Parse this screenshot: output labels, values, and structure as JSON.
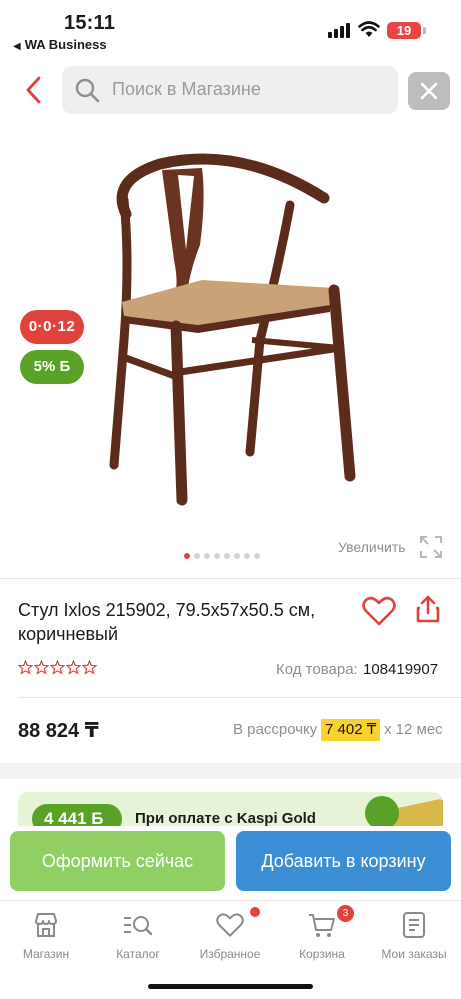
{
  "status_bar": {
    "time": "15:11",
    "back_app": "WA Business",
    "battery": "19"
  },
  "header": {
    "search_placeholder": "Поиск в Магазине"
  },
  "product": {
    "badge_installment": "0·0·12",
    "badge_bonus": "5% Б",
    "image_count": 8,
    "active_image": 1,
    "zoom_label": "Увеличить",
    "title": "Стул Ixlos 215902, 79.5x57x50.5 см, коричневый",
    "rating": 0,
    "rating_max": 5,
    "code_label": "Код товара:",
    "code_value": "108419907",
    "price": "88 824 ₸",
    "installment_label": "В рассрочку",
    "installment_amount": "7 402 ₸",
    "installment_months": "x 12 мес"
  },
  "promo": {
    "bonus": "4 441 Б",
    "text": "При оплате с Kaspi Gold"
  },
  "actions": {
    "buy_now": "Оформить сейчас",
    "add_to_cart": "Добавить в корзину"
  },
  "tabbar": {
    "items": [
      {
        "label": "Магазин",
        "icon": "shop-icon"
      },
      {
        "label": "Каталог",
        "icon": "catalog-icon"
      },
      {
        "label": "Избранное",
        "icon": "heart-icon"
      },
      {
        "label": "Корзина",
        "icon": "cart-icon"
      },
      {
        "label": "Мои заказы",
        "icon": "orders-icon"
      }
    ],
    "cart_count": "3"
  },
  "colors": {
    "accent_red": "#e0423c",
    "green": "#5aa128",
    "blue": "#3c8ed4",
    "yellow": "#fbd22d"
  }
}
